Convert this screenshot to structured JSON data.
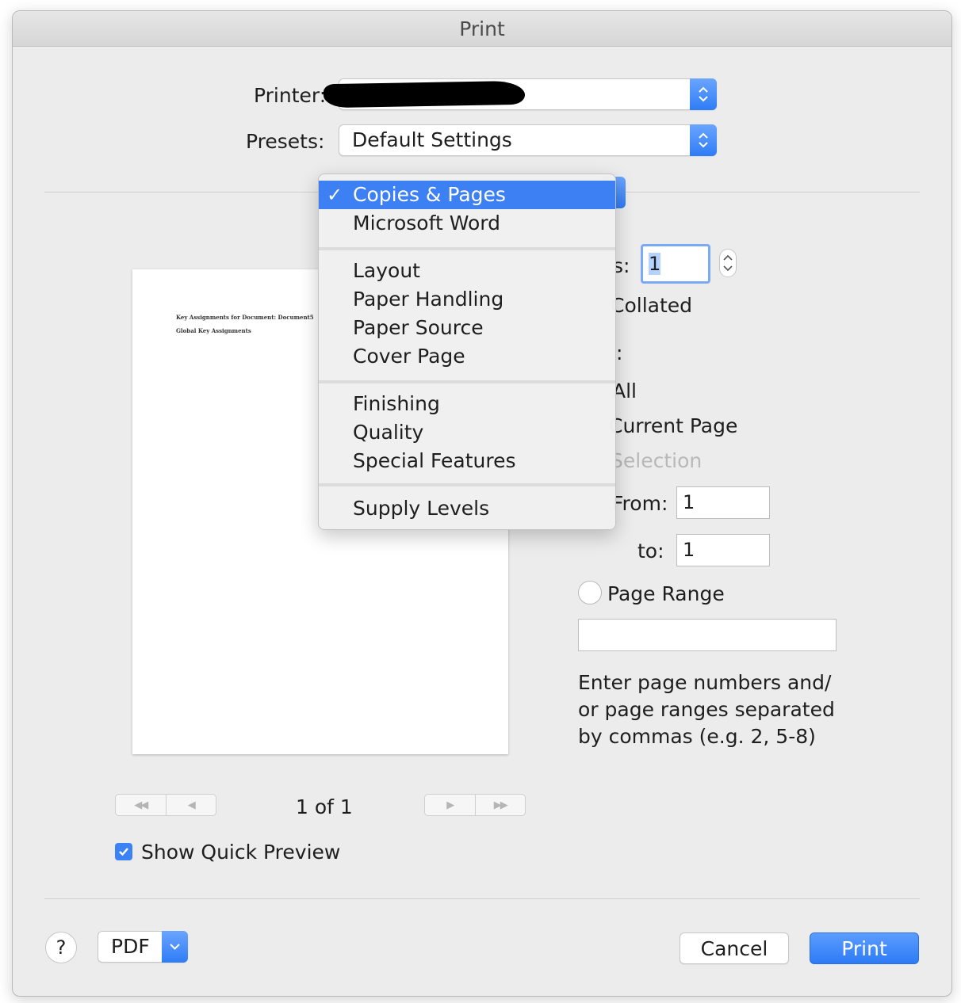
{
  "window": {
    "title": "Print"
  },
  "printer": {
    "label": "Printer:",
    "value": ""
  },
  "presets": {
    "label": "Presets:",
    "value": "Default Settings"
  },
  "pane_menu": {
    "selected": "Copies & Pages",
    "check_glyph": "✓",
    "groups": [
      [
        "Copies & Pages",
        "Microsoft Word"
      ],
      [
        "Layout",
        "Paper Handling",
        "Paper Source",
        "Cover Page"
      ],
      [
        "Finishing",
        "Quality",
        "Special Features"
      ],
      [
        "Supply Levels"
      ]
    ]
  },
  "preview": {
    "line1": "Key Assignments for Document: Document5",
    "line2": "Global Key Assignments",
    "page_indicator": "1 of 1",
    "first_glyph": "◀◀",
    "prev_glyph": "◀",
    "next_glyph": "▶",
    "last_glyph": "▶▶"
  },
  "copies": {
    "label_visible": "s:",
    "value": "1",
    "collated_label_visible": "Collated"
  },
  "pages": {
    "label_visible": ":",
    "all_label_visible": "All",
    "current_page_label_visible": "Current Page",
    "selection_label_visible": "Selection",
    "from_label_visible": "From:",
    "from_value": "1",
    "to_label": "to:",
    "to_value": "1",
    "page_range_label": "Page Range",
    "page_range_value": "",
    "help_text_1": "Enter page numbers and/",
    "help_text_2": "or page ranges separated",
    "help_text_3": "by commas (e.g. 2, 5-8)"
  },
  "show_quick_preview": {
    "label": "Show Quick Preview",
    "checked": true
  },
  "footer": {
    "help_label": "?",
    "pdf_label": "PDF",
    "cancel_label": "Cancel",
    "print_label": "Print"
  },
  "colors": {
    "accent": "#3d80f3",
    "window_bg": "#ececec"
  }
}
